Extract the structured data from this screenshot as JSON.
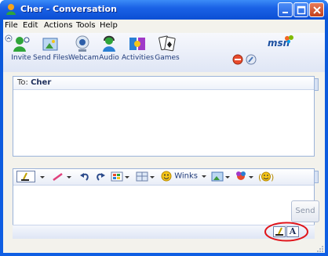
{
  "window": {
    "title": "Cher - Conversation"
  },
  "menu": {
    "items": [
      "File",
      "Edit",
      "Actions",
      "Tools",
      "Help"
    ]
  },
  "toolbar": {
    "items": [
      {
        "label": "Invite",
        "icon": "invite-icon"
      },
      {
        "label": "Send Files",
        "icon": "send-files-icon"
      },
      {
        "label": "Webcam",
        "icon": "webcam-icon"
      },
      {
        "label": "Audio",
        "icon": "audio-icon"
      },
      {
        "label": "Activities",
        "icon": "activities-icon"
      },
      {
        "label": "Games",
        "icon": "games-icon"
      }
    ],
    "logo": "msn"
  },
  "conversation": {
    "to_label": "To:",
    "contact": "Cher"
  },
  "format_bar": {
    "winks_label": "Winks"
  },
  "compose": {
    "send_label": "Send",
    "font_button": "A"
  },
  "colors": {
    "titlebar": "#1a62e6",
    "highlight_ring": "#e0151b",
    "panel_border": "#9bb3d9"
  }
}
